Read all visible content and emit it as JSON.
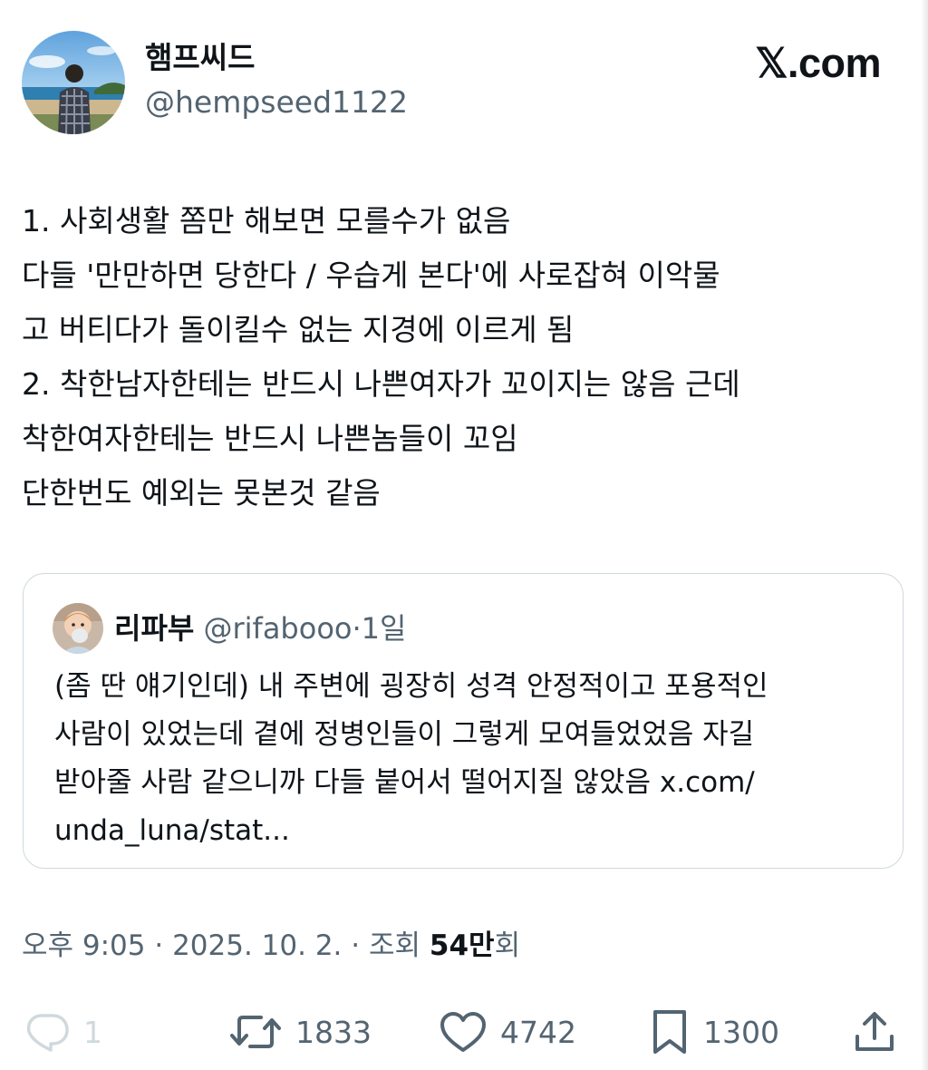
{
  "author": {
    "name": "햄프씨드",
    "handle": "@hempseed1122"
  },
  "brand": "𝕏.com",
  "tweet": {
    "lines": [
      "1. 사회생활 쫌만 해보면 모를수가 없음",
      "다들 '만만하면 당한다 / 우습게 본다'에 사로잡혀 이악물",
      "고 버티다가 돌이킬수 없는 지경에 이르게 됨",
      "2. 착한남자한테는 반드시 나쁜여자가 꼬이지는 않음 근데",
      "착한여자한테는 반드시 나쁜놈들이 꼬임",
      "단한번도 예외는 못본것 같음"
    ]
  },
  "quote": {
    "name": "리파부",
    "handle": "@rifabooo",
    "separator": "·",
    "time": "1일",
    "lines": [
      "(좀 딴 얘기인데) 내 주변에 굉장히 성격 안정적이고 포용적인",
      "사람이 있었는데 곁에 정병인들이 그렇게 모여들었었음 자길",
      "받아줄 사람 같으니까 다들 붙어서 떨어지질 않았음 x.com/",
      "unda_luna/stat..."
    ]
  },
  "meta": {
    "time": "오후 9:05",
    "sep1": " · ",
    "date": "2025. 10. 2.",
    "sep2": " · ",
    "views_label": "조회 ",
    "views_count": "54만",
    "views_suffix": "회"
  },
  "actions": {
    "reply_count": "1",
    "repost_count": "1833",
    "like_count": "4742",
    "bookmark_count": "1300"
  },
  "colors": {
    "text": "#0f1419",
    "secondary": "#536471",
    "border": "#cfd9de",
    "reply_disabled": "#cfd9de"
  },
  "icons": [
    "reply-icon",
    "repost-icon",
    "like-icon",
    "bookmark-icon",
    "share-icon"
  ]
}
